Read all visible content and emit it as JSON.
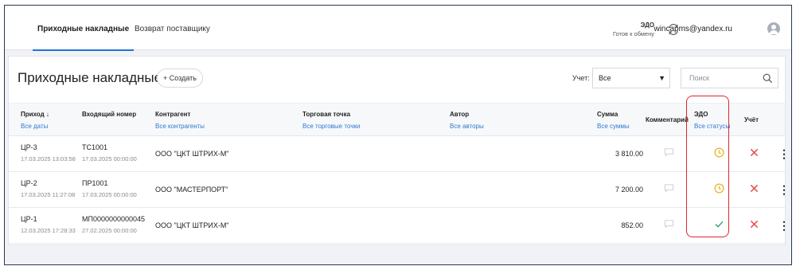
{
  "nav": {
    "tabs": [
      {
        "label": "Приходные накладные",
        "active": true
      },
      {
        "label": "Возврат поставщику",
        "active": false
      }
    ],
    "edo": {
      "title": "ЭДО",
      "status": "Готов к обмену"
    },
    "user_email": "wincapms@yandex.ru"
  },
  "page": {
    "title": "Приходные накладные",
    "create_label": "+ Создать",
    "uchet_label": "Учет:",
    "uchet_value": "Все",
    "search_placeholder": "Поиск"
  },
  "table": {
    "columns": [
      {
        "title": "Приход ↓",
        "filter": "Все даты"
      },
      {
        "title": "Входящий номер",
        "filter": ""
      },
      {
        "title": "Контрагент",
        "filter": "Все контрагенты"
      },
      {
        "title": "Торговая точка",
        "filter": "Все торговые точки"
      },
      {
        "title": "Автор",
        "filter": "Все авторы"
      },
      {
        "title": "Сумма",
        "filter": "Все суммы"
      },
      {
        "title": "Комментарий",
        "filter": ""
      },
      {
        "title": "ЭДО",
        "filter": "Все статусы"
      },
      {
        "title": "Учёт",
        "filter": ""
      }
    ],
    "rows": [
      {
        "id": "ЦР-3",
        "created": "17.03.2025 13:03:58",
        "incoming_no": "ТС1001",
        "incoming_date": "17.03.2025 00:00:00",
        "counterparty": "ООО \"ЦКТ ШТРИХ-М\"",
        "sum": "3 810.00",
        "edo_status": "pending-clock-icon"
      },
      {
        "id": "ЦР-2",
        "created": "17.03.2025 11:27:08",
        "incoming_no": "ПР1001",
        "incoming_date": "17.03.2025 00:00:00",
        "counterparty": "ООО \"МАСТЕРПОРТ\"",
        "sum": "7 200.00",
        "edo_status": "pending-clock-icon"
      },
      {
        "id": "ЦР-1",
        "created": "12.03.2025 17:28:33",
        "incoming_no": "МП0000000000045",
        "incoming_date": "27.02.2025 00:00:00",
        "counterparty": "ООО \"ЦКТ ШТРИХ-М\"",
        "sum": "852.00",
        "edo_status": "check-icon"
      }
    ]
  },
  "colors": {
    "accent": "#1e73d8",
    "link": "#2f78d0",
    "clock": "#e8b21c",
    "check": "#27a86b",
    "cross": "#e64545",
    "highlight": "#e3232f"
  }
}
